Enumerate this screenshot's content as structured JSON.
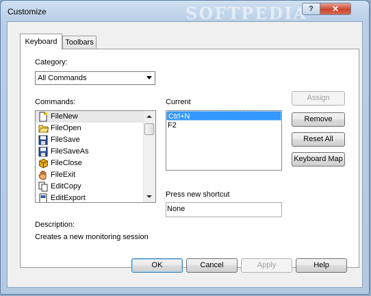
{
  "window": {
    "title": "Customize",
    "watermark": "SOFTPEDIA"
  },
  "titlebar_buttons": {
    "help": "?",
    "close": "✕"
  },
  "tabs": [
    {
      "label": "Keyboard",
      "active": true
    },
    {
      "label": "Toolbars",
      "active": false
    }
  ],
  "category": {
    "label": "Category:",
    "value": "All Commands"
  },
  "commands": {
    "label": "Commands:",
    "items": [
      {
        "label": "FileNew",
        "icon": "new-file-icon",
        "selected": true
      },
      {
        "label": "FileOpen",
        "icon": "open-folder-icon"
      },
      {
        "label": "FileSave",
        "icon": "floppy-disk-icon"
      },
      {
        "label": "FileSaveAs",
        "icon": "floppy-disk-icon"
      },
      {
        "label": "FileClose",
        "icon": "close-box-icon"
      },
      {
        "label": "FileExit",
        "icon": "hand-icon"
      },
      {
        "label": "EditCopy",
        "icon": "copy-icon"
      },
      {
        "label": "EditExport",
        "icon": "export-icon"
      }
    ]
  },
  "current": {
    "label": "Current",
    "items": [
      {
        "label": "Ctrl+N",
        "selected": true
      },
      {
        "label": "F2"
      }
    ]
  },
  "shortcut": {
    "label": "Press new shortcut",
    "value": "None"
  },
  "side_buttons": {
    "assign": "Assign",
    "remove": "Remove",
    "reset_all": "Reset All",
    "keyboard_map": "Keyboard Map"
  },
  "description": {
    "label": "Description:",
    "text": "Creates a new monitoring session"
  },
  "dialog_buttons": {
    "ok": "OK",
    "cancel": "Cancel",
    "apply": "Apply",
    "help": "Help"
  }
}
